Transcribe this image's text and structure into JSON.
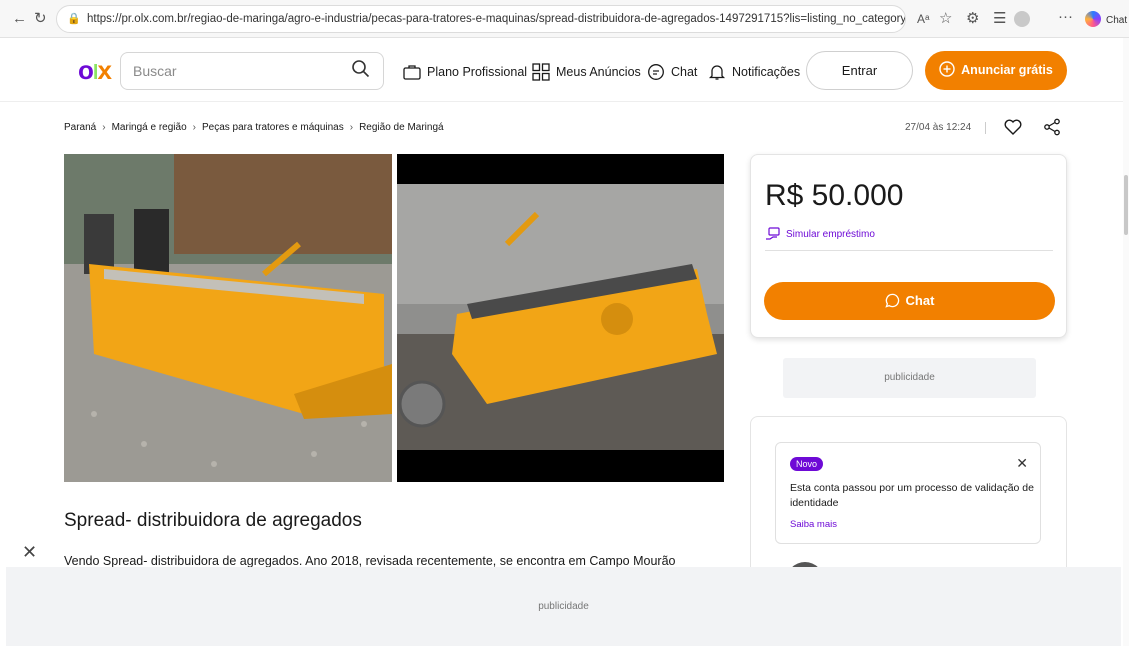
{
  "browser": {
    "url": "https://pr.olx.com.br/regiao-de-maringa/agro-e-industria/pecas-para-tratores-e-maquinas/spread-distribuidora-de-agregados-1497291715?lis=listing_no_category",
    "chat_label": "Chat",
    "read_aloud_label": "Aᵃ",
    "more_label": "···"
  },
  "header": {
    "logo": {
      "o": "o",
      "l": "l",
      "x": "x"
    },
    "search_placeholder": "Buscar",
    "nav": {
      "plano": "Plano Profissional",
      "anuncios": "Meus Anúncios",
      "chat": "Chat",
      "notificacoes": "Notificações"
    },
    "entrar": "Entrar",
    "anunciar": "Anunciar grátis"
  },
  "breadcrumb": [
    "Paraná",
    "Maringá e região",
    "Peças para tratores e máquinas",
    "Região de Maringá"
  ],
  "date": "27/04 às 12:24",
  "listing": {
    "title": "Spread- distribuidora de agregados",
    "description": "Vendo Spread- distribuidora de agregados. Ano 2018, revisada recentemente, se encontra em Campo Mourão"
  },
  "price_card": {
    "price": "R$ 50.000",
    "simular": "Simular empréstimo",
    "chat": "Chat"
  },
  "publicidade_side": "publicidade",
  "publicidade_footer": "publicidade",
  "verification": {
    "badge": "Novo",
    "text": "Esta conta passou por um processo de validação de identidade",
    "link": "Saiba mais"
  },
  "colors": {
    "brand_purple": "#6e0ad6",
    "brand_orange": "#f28000",
    "brand_green": "#8ce563"
  }
}
